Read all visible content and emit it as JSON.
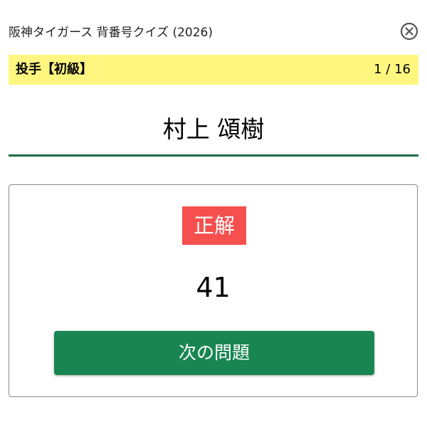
{
  "header": {
    "title": "阪神タイガース 背番号クイズ (2026)",
    "close_icon": "close-circle-icon"
  },
  "category": {
    "label": "投手【初級】",
    "progress": "1 / 16",
    "background_color": "#fff67f"
  },
  "question": {
    "player_name": "村上 頌樹",
    "underline_color": "#1e6d48"
  },
  "result": {
    "badge_text": "正解",
    "badge_color": "#f5504e",
    "answer_number": "41",
    "next_button_label": "次の問題",
    "next_button_color": "#198651"
  }
}
